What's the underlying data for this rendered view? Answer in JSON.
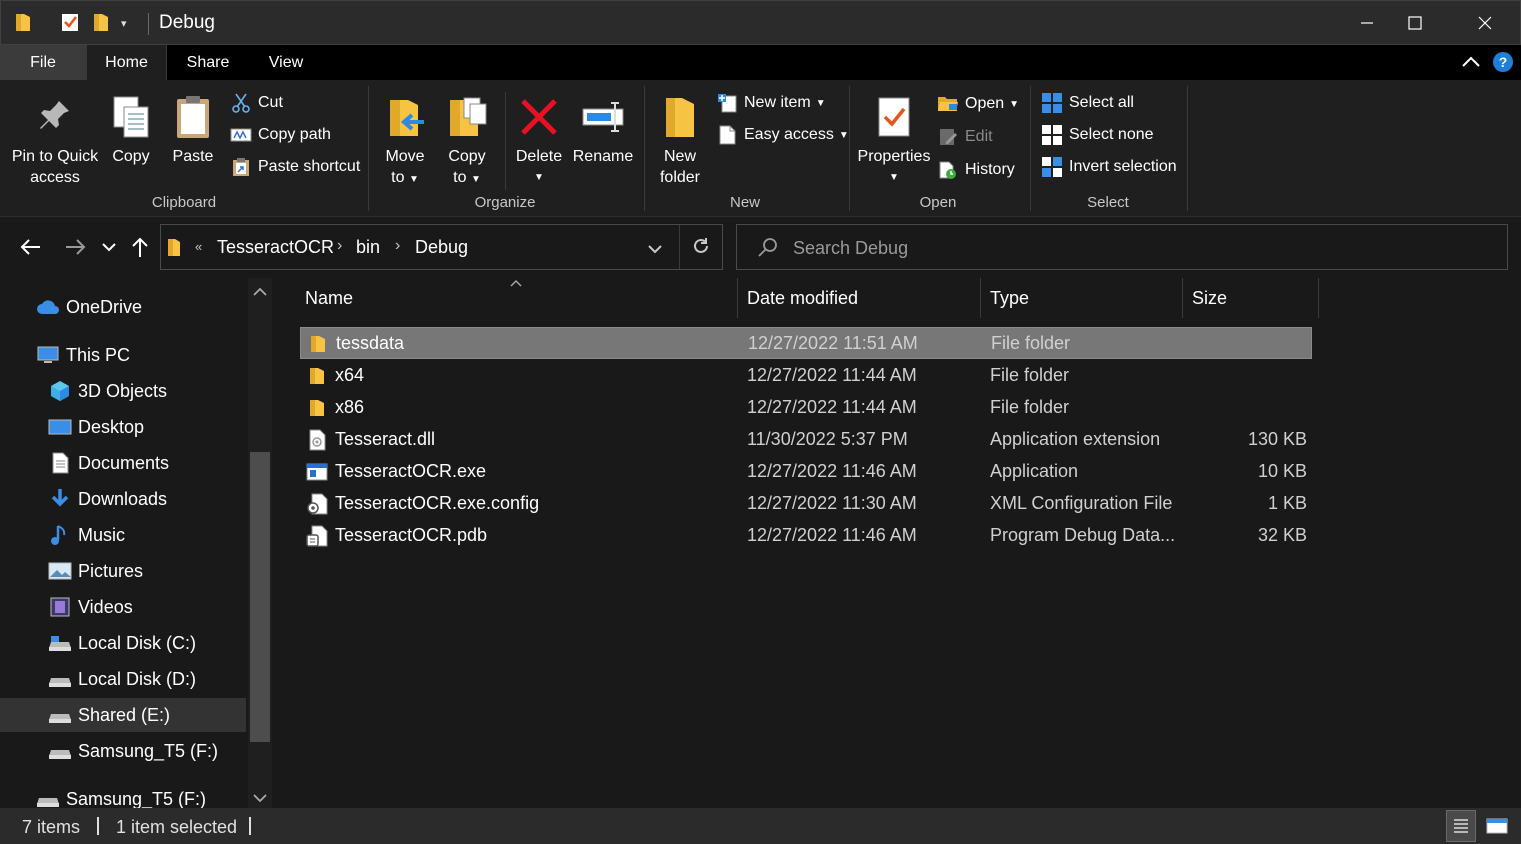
{
  "window": {
    "title": "Debug",
    "minimize": "minimize",
    "maximize": "maximize",
    "close": "close"
  },
  "ribbon_tabs": [
    "File",
    "Home",
    "Share",
    "View"
  ],
  "ribbon": {
    "clipboard": {
      "label": "Clipboard",
      "pin_line1": "Pin to Quick",
      "pin_line2": "access",
      "copy": "Copy",
      "paste": "Paste",
      "cut": "Cut",
      "copy_path": "Copy path",
      "paste_shortcut": "Paste shortcut"
    },
    "organize": {
      "label": "Organize",
      "move_line1": "Move",
      "move_line2": "to",
      "copy_line1": "Copy",
      "copy_line2": "to",
      "delete": "Delete",
      "rename": "Rename"
    },
    "new": {
      "label": "New",
      "new_folder_line1": "New",
      "new_folder_line2": "folder",
      "new_item": "New item",
      "easy_access": "Easy access"
    },
    "open": {
      "label": "Open",
      "properties": "Properties",
      "open": "Open",
      "edit": "Edit",
      "history": "History"
    },
    "select": {
      "label": "Select",
      "select_all": "Select all",
      "select_none": "Select none",
      "invert_selection": "Invert selection"
    }
  },
  "address": {
    "overflow": "«",
    "crumbs": [
      "TesseractOCR",
      "bin",
      "Debug"
    ]
  },
  "search": {
    "placeholder": "Search Debug"
  },
  "nav_pane": {
    "items": [
      {
        "label": "OneDrive",
        "icon": "cloud-icon"
      },
      {
        "label": "This PC",
        "icon": "computer-icon"
      },
      {
        "label": "3D Objects",
        "icon": "cube-icon"
      },
      {
        "label": "Desktop",
        "icon": "desktop-icon"
      },
      {
        "label": "Documents",
        "icon": "document-icon"
      },
      {
        "label": "Downloads",
        "icon": "download-icon"
      },
      {
        "label": "Music",
        "icon": "music-icon"
      },
      {
        "label": "Pictures",
        "icon": "picture-icon"
      },
      {
        "label": "Videos",
        "icon": "video-icon"
      },
      {
        "label": "Local Disk (C:)",
        "icon": "drive-icon"
      },
      {
        "label": "Local Disk (D:)",
        "icon": "drive-icon"
      },
      {
        "label": "Shared (E:)",
        "icon": "drive-icon"
      },
      {
        "label": "Samsung_T5 (F:)",
        "icon": "drive-icon"
      },
      {
        "label": "Samsung_T5 (F:)",
        "icon": "drive-icon"
      }
    ],
    "selected": "Shared (E:)"
  },
  "columns": {
    "name": "Name",
    "date_modified": "Date modified",
    "type": "Type",
    "size": "Size"
  },
  "files": [
    {
      "name": "tessdata",
      "date": "12/27/2022 11:51 AM",
      "type": "File folder",
      "size": "",
      "icon": "folder-icon",
      "selected": true
    },
    {
      "name": "x64",
      "date": "12/27/2022 11:44 AM",
      "type": "File folder",
      "size": "",
      "icon": "folder-icon"
    },
    {
      "name": "x86",
      "date": "12/27/2022 11:44 AM",
      "type": "File folder",
      "size": "",
      "icon": "folder-icon"
    },
    {
      "name": "Tesseract.dll",
      "date": "11/30/2022 5:37 PM",
      "type": "Application extension",
      "size": "130 KB",
      "icon": "dll-file-icon"
    },
    {
      "name": "TesseractOCR.exe",
      "date": "12/27/2022 11:46 AM",
      "type": "Application",
      "size": "10 KB",
      "icon": "exe-file-icon"
    },
    {
      "name": "TesseractOCR.exe.config",
      "date": "12/27/2022 11:30 AM",
      "type": "XML Configuration File",
      "size": "1 KB",
      "icon": "config-file-icon"
    },
    {
      "name": "TesseractOCR.pdb",
      "date": "12/27/2022 11:46 AM",
      "type": "Program Debug Data...",
      "size": "32 KB",
      "icon": "pdb-file-icon"
    }
  ],
  "status": {
    "items_count": "7 items",
    "selected_count": "1 item selected"
  },
  "colors": {
    "folder": "#f6c343",
    "accent": "#3a8ee6",
    "selected_row": "#777777",
    "delete_red": "#e81123"
  }
}
